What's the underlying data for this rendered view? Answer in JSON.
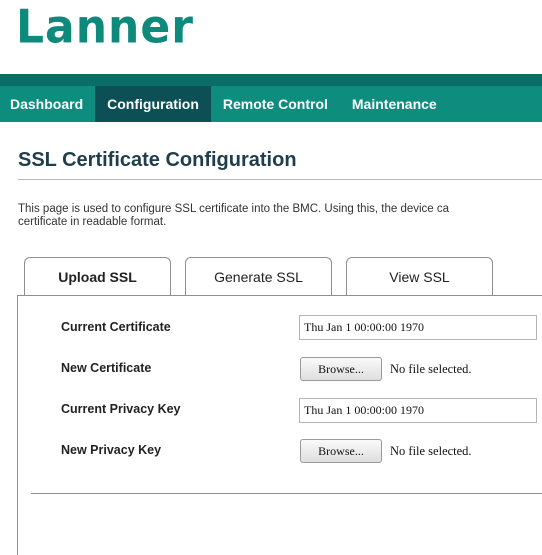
{
  "logo": {
    "text": "Lanner"
  },
  "nav": {
    "items": [
      {
        "label": "Dashboard",
        "active": false
      },
      {
        "label": "Configuration",
        "active": true
      },
      {
        "label": "Remote Control",
        "active": false
      },
      {
        "label": "Maintenance",
        "active": false
      }
    ]
  },
  "page": {
    "title": "SSL Certificate Configuration",
    "description_line1": "This page is used to configure SSL certificate into the BMC. Using this, the device ca",
    "description_line2": "certificate in readable format."
  },
  "tabs": [
    {
      "label": "Upload SSL",
      "active": true
    },
    {
      "label": "Generate SSL",
      "active": false
    },
    {
      "label": "View SSL",
      "active": false
    }
  ],
  "form": {
    "current_certificate": {
      "label": "Current Certificate",
      "value": "Thu Jan  1 00:00:00 1970"
    },
    "new_certificate": {
      "label": "New Certificate",
      "button": "Browse...",
      "status": "No file selected."
    },
    "current_privacy_key": {
      "label": "Current Privacy Key",
      "value": "Thu Jan  1 00:00:00 1970"
    },
    "new_privacy_key": {
      "label": "New Privacy Key",
      "button": "Browse...",
      "status": "No file selected."
    }
  },
  "colors": {
    "brand": "#0d8a7b",
    "nav_bar": "#0e8d7e",
    "nav_active": "#0c4f55",
    "title": "#1f3d4a"
  }
}
